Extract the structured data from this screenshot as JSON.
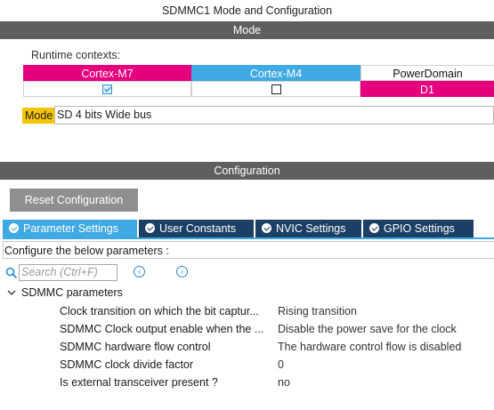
{
  "window": {
    "title": "SDMMC1 Mode and Configuration"
  },
  "mode_section": {
    "header": "Mode",
    "runtime_label": "Runtime contexts:",
    "contexts": [
      {
        "label": "Cortex-M7",
        "checked": true,
        "color": "#e6007e"
      },
      {
        "label": "Cortex-M4",
        "checked": false,
        "color": "#3fa9e4"
      },
      {
        "label": "PowerDomain",
        "value": "D1",
        "color": "#e6007e"
      }
    ],
    "mode_label": "Mode",
    "mode_value": "SD 4 bits Wide bus"
  },
  "config_section": {
    "header": "Configuration",
    "reset_button": "Reset Configuration",
    "tabs": [
      {
        "label": "Parameter Settings",
        "active": true
      },
      {
        "label": "User Constants",
        "active": false
      },
      {
        "label": "NVIC Settings",
        "active": false
      },
      {
        "label": "GPIO Settings",
        "active": false
      }
    ],
    "instructions": "Configure the below parameters :",
    "search_placeholder": "Search (Ctrl+F)",
    "group": "SDMMC parameters",
    "params": [
      {
        "name": "Clock transition on which the bit captur...",
        "value": "Rising transition"
      },
      {
        "name": "SDMMC Clock output enable when the ...",
        "value": "Disable the power save for the clock"
      },
      {
        "name": "SDMMC hardware flow control",
        "value": "The hardware control flow is disabled"
      },
      {
        "name": "SDMMC clock divide factor",
        "value": "0"
      },
      {
        "name": "Is external transceiver present ?",
        "value": "no"
      }
    ]
  },
  "colors": {
    "bar": "#5f5f5f",
    "magenta": "#e6007e",
    "blue": "#3fa9e4",
    "tab_dark": "#1c3f66",
    "mode_tag": "#f5c400"
  }
}
